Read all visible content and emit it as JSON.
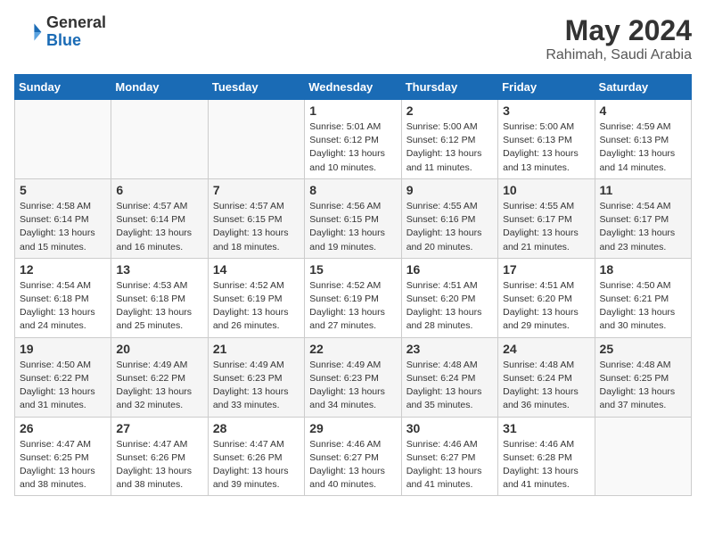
{
  "header": {
    "logo_general": "General",
    "logo_blue": "Blue",
    "month_year": "May 2024",
    "location": "Rahimah, Saudi Arabia"
  },
  "weekdays": [
    "Sunday",
    "Monday",
    "Tuesday",
    "Wednesday",
    "Thursday",
    "Friday",
    "Saturday"
  ],
  "weeks": [
    [
      {
        "day": "",
        "info": ""
      },
      {
        "day": "",
        "info": ""
      },
      {
        "day": "",
        "info": ""
      },
      {
        "day": "1",
        "info": "Sunrise: 5:01 AM\nSunset: 6:12 PM\nDaylight: 13 hours\nand 10 minutes."
      },
      {
        "day": "2",
        "info": "Sunrise: 5:00 AM\nSunset: 6:12 PM\nDaylight: 13 hours\nand 11 minutes."
      },
      {
        "day": "3",
        "info": "Sunrise: 5:00 AM\nSunset: 6:13 PM\nDaylight: 13 hours\nand 13 minutes."
      },
      {
        "day": "4",
        "info": "Sunrise: 4:59 AM\nSunset: 6:13 PM\nDaylight: 13 hours\nand 14 minutes."
      }
    ],
    [
      {
        "day": "5",
        "info": "Sunrise: 4:58 AM\nSunset: 6:14 PM\nDaylight: 13 hours\nand 15 minutes."
      },
      {
        "day": "6",
        "info": "Sunrise: 4:57 AM\nSunset: 6:14 PM\nDaylight: 13 hours\nand 16 minutes."
      },
      {
        "day": "7",
        "info": "Sunrise: 4:57 AM\nSunset: 6:15 PM\nDaylight: 13 hours\nand 18 minutes."
      },
      {
        "day": "8",
        "info": "Sunrise: 4:56 AM\nSunset: 6:15 PM\nDaylight: 13 hours\nand 19 minutes."
      },
      {
        "day": "9",
        "info": "Sunrise: 4:55 AM\nSunset: 6:16 PM\nDaylight: 13 hours\nand 20 minutes."
      },
      {
        "day": "10",
        "info": "Sunrise: 4:55 AM\nSunset: 6:17 PM\nDaylight: 13 hours\nand 21 minutes."
      },
      {
        "day": "11",
        "info": "Sunrise: 4:54 AM\nSunset: 6:17 PM\nDaylight: 13 hours\nand 23 minutes."
      }
    ],
    [
      {
        "day": "12",
        "info": "Sunrise: 4:54 AM\nSunset: 6:18 PM\nDaylight: 13 hours\nand 24 minutes."
      },
      {
        "day": "13",
        "info": "Sunrise: 4:53 AM\nSunset: 6:18 PM\nDaylight: 13 hours\nand 25 minutes."
      },
      {
        "day": "14",
        "info": "Sunrise: 4:52 AM\nSunset: 6:19 PM\nDaylight: 13 hours\nand 26 minutes."
      },
      {
        "day": "15",
        "info": "Sunrise: 4:52 AM\nSunset: 6:19 PM\nDaylight: 13 hours\nand 27 minutes."
      },
      {
        "day": "16",
        "info": "Sunrise: 4:51 AM\nSunset: 6:20 PM\nDaylight: 13 hours\nand 28 minutes."
      },
      {
        "day": "17",
        "info": "Sunrise: 4:51 AM\nSunset: 6:20 PM\nDaylight: 13 hours\nand 29 minutes."
      },
      {
        "day": "18",
        "info": "Sunrise: 4:50 AM\nSunset: 6:21 PM\nDaylight: 13 hours\nand 30 minutes."
      }
    ],
    [
      {
        "day": "19",
        "info": "Sunrise: 4:50 AM\nSunset: 6:22 PM\nDaylight: 13 hours\nand 31 minutes."
      },
      {
        "day": "20",
        "info": "Sunrise: 4:49 AM\nSunset: 6:22 PM\nDaylight: 13 hours\nand 32 minutes."
      },
      {
        "day": "21",
        "info": "Sunrise: 4:49 AM\nSunset: 6:23 PM\nDaylight: 13 hours\nand 33 minutes."
      },
      {
        "day": "22",
        "info": "Sunrise: 4:49 AM\nSunset: 6:23 PM\nDaylight: 13 hours\nand 34 minutes."
      },
      {
        "day": "23",
        "info": "Sunrise: 4:48 AM\nSunset: 6:24 PM\nDaylight: 13 hours\nand 35 minutes."
      },
      {
        "day": "24",
        "info": "Sunrise: 4:48 AM\nSunset: 6:24 PM\nDaylight: 13 hours\nand 36 minutes."
      },
      {
        "day": "25",
        "info": "Sunrise: 4:48 AM\nSunset: 6:25 PM\nDaylight: 13 hours\nand 37 minutes."
      }
    ],
    [
      {
        "day": "26",
        "info": "Sunrise: 4:47 AM\nSunset: 6:25 PM\nDaylight: 13 hours\nand 38 minutes."
      },
      {
        "day": "27",
        "info": "Sunrise: 4:47 AM\nSunset: 6:26 PM\nDaylight: 13 hours\nand 38 minutes."
      },
      {
        "day": "28",
        "info": "Sunrise: 4:47 AM\nSunset: 6:26 PM\nDaylight: 13 hours\nand 39 minutes."
      },
      {
        "day": "29",
        "info": "Sunrise: 4:46 AM\nSunset: 6:27 PM\nDaylight: 13 hours\nand 40 minutes."
      },
      {
        "day": "30",
        "info": "Sunrise: 4:46 AM\nSunset: 6:27 PM\nDaylight: 13 hours\nand 41 minutes."
      },
      {
        "day": "31",
        "info": "Sunrise: 4:46 AM\nSunset: 6:28 PM\nDaylight: 13 hours\nand 41 minutes."
      },
      {
        "day": "",
        "info": ""
      }
    ]
  ]
}
